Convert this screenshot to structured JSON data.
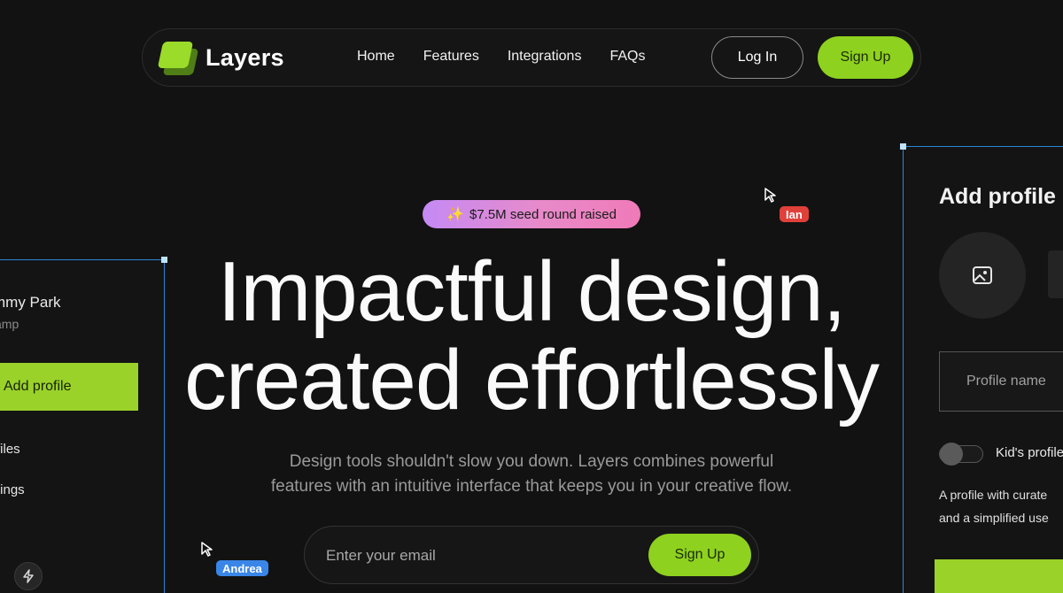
{
  "brand": {
    "name": "Layers"
  },
  "nav": {
    "links": [
      "Home",
      "Features",
      "Integrations",
      "FAQs"
    ],
    "login_label": "Log In",
    "signup_label": "Sign Up"
  },
  "badge": {
    "text": "$7.5M seed round raised",
    "icon": "sparkles-icon"
  },
  "hero": {
    "title_line1": "Impactful design,",
    "title_line2": "created effortlessly",
    "subtitle_line1": "Design tools shouldn't slow you down. Layers combines powerful",
    "subtitle_line2": "features with an intuitive interface that keeps you in your creative flow."
  },
  "email_form": {
    "placeholder": "Enter your email",
    "button_label": "Sign Up"
  },
  "left_panel": {
    "name": "mmy Park",
    "sub": "amp",
    "add_button": "Add profile",
    "items": [
      "files",
      "tings",
      ":"
    ]
  },
  "right_panel": {
    "title": "Add profile",
    "input_placeholder": "Profile name",
    "toggle_label": "Kid's profile",
    "desc_line1": "A profile with curate",
    "desc_line2": "and a simplified use"
  },
  "cursors": [
    {
      "name": "Ian",
      "color": "#e0403a"
    },
    {
      "name": "Andrea",
      "color": "#3a86e8"
    }
  ],
  "colors": {
    "accent": "#8ed11f",
    "background": "#121212",
    "selection": "#2a86d6"
  }
}
